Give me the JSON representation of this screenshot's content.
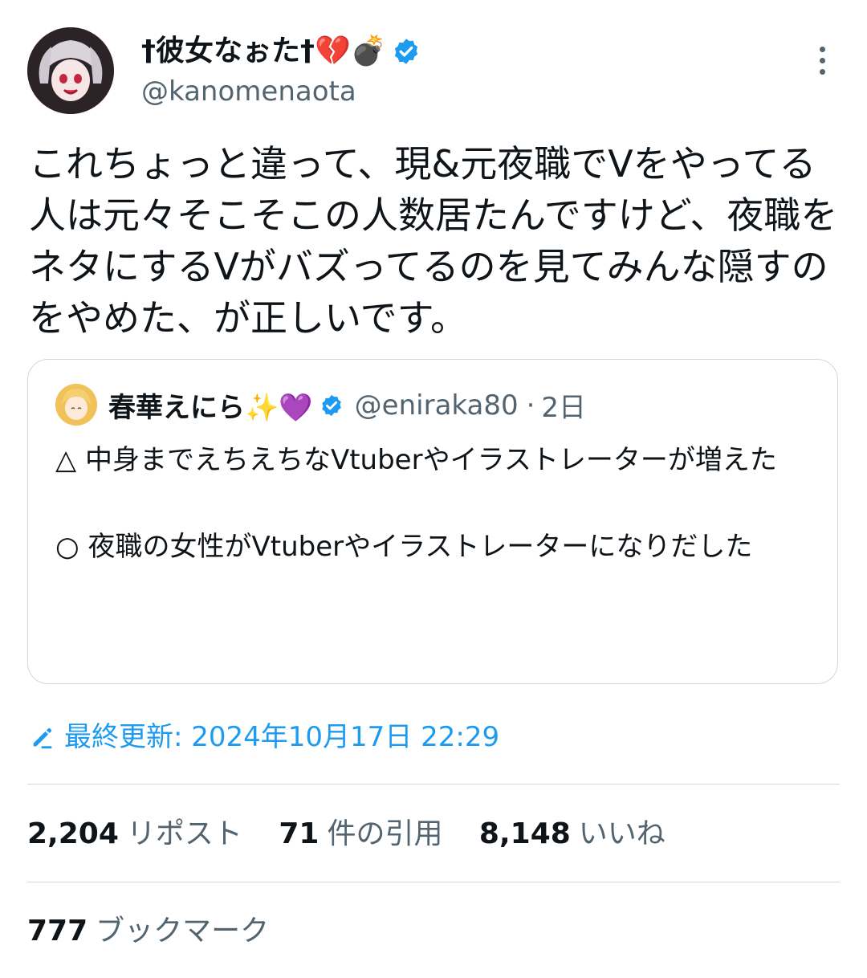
{
  "author": {
    "display_name": "†彼女なぉた†💔💣",
    "handle": "@kanomenaota",
    "verified": true
  },
  "tweet": {
    "text": "これちょっと違って、現&元夜職でVをやってる人は元々そこそこの人数居たんですけど、夜職をネタにするVがバズってるのを見てみんな隠すのをやめた、が正しいです。"
  },
  "quote": {
    "display_name": "春華えにら✨💜",
    "handle": "@eniraka80",
    "separator": "·",
    "time": "2日",
    "text": "△ 中身までえちえちなVtuberやイラストレーターが増えた\n\n○ 夜職の女性がVtuberやイラストレーターになりだした"
  },
  "last_updated": "最終更新: 2024年10月17日 22:29",
  "stats": {
    "reposts_count": "2,204",
    "reposts_label": "リポスト",
    "quotes_count": "71",
    "quotes_label": "件の引用",
    "likes_count": "8,148",
    "likes_label": "いいね",
    "bookmarks_count": "777",
    "bookmarks_label": "ブックマーク"
  },
  "colors": {
    "accent": "#1d9bf0",
    "secondary_text": "#536471",
    "border": "#cfd9de"
  },
  "icons": {
    "verified": "verified-badge-icon",
    "more": "more-options-icon",
    "edit": "edit-pencil-icon"
  }
}
